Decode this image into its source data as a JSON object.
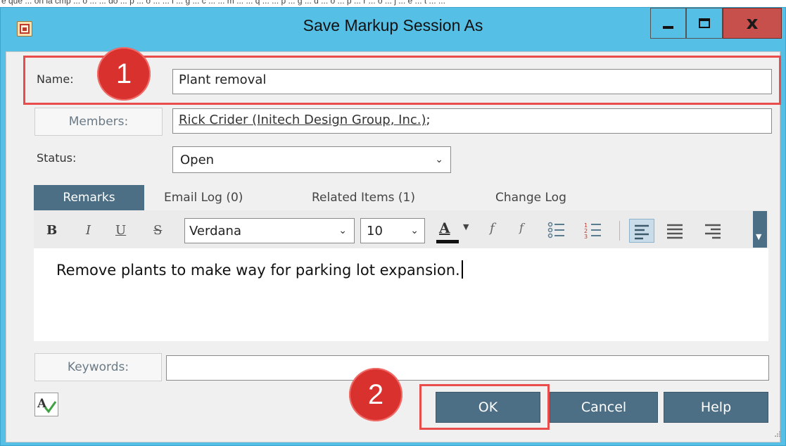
{
  "doc_caption": "e que ... on la cmp ... o ... ... do ... p ... o ... ... l ... g ... c ... ... m ... ... q ... ... p ... g ... d ... o ... p ... r ... o ... j ... e ... t ... ...",
  "window": {
    "title": "Save Markup Session As",
    "minimize_label": "_",
    "close_label": "x"
  },
  "form": {
    "name_label": "Name:",
    "name_value": "Plant removal",
    "members_button": "Members:",
    "members_link": "Rick Crider (Initech Design Group, Inc.)",
    "members_suffix": ";",
    "status_label": "Status:",
    "status_value": "Open",
    "keywords_button": "Keywords:",
    "keywords_value": ""
  },
  "tabs": [
    {
      "label": "Remarks",
      "active": true
    },
    {
      "label": "Email Log (0)",
      "active": false
    },
    {
      "label": "Related Items (1)",
      "active": false
    },
    {
      "label": "Change Log",
      "active": false
    }
  ],
  "toolbar": {
    "bold": "B",
    "italic": "I",
    "underline": "U",
    "strike": "S",
    "font_family": "Verdana",
    "font_size": "10",
    "font_color_label": "A",
    "func1": "f",
    "func2": "f"
  },
  "remarks_text": "Remove plants to make way for parking lot expansion.",
  "buttons": {
    "ok": "OK",
    "cancel": "Cancel",
    "help": "Help"
  },
  "annotations": {
    "badge_1": "1",
    "badge_2": "2"
  },
  "colors": {
    "titlebar": "#55bfe6",
    "accent": "#4d6f85",
    "annotation": "#e84d4b",
    "close_button": "#c7504c"
  }
}
